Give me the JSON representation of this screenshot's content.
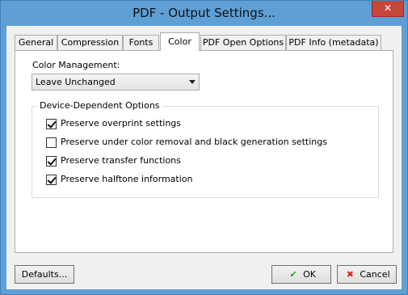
{
  "window": {
    "title": "PDF - Output Settings..."
  },
  "titlebar": {
    "close_glyph": "✕"
  },
  "tabs": [
    {
      "label": "General",
      "active": false
    },
    {
      "label": "Compression",
      "active": false
    },
    {
      "label": "Fonts",
      "active": false
    },
    {
      "label": "Color",
      "active": true
    },
    {
      "label": "PDF Open Options",
      "active": false
    },
    {
      "label": "PDF Info (metadata)",
      "active": false
    }
  ],
  "color_tab": {
    "color_management_label": "Color Management:",
    "color_management_value": "Leave Unchanged",
    "device_options": {
      "legend": "Device-Dependent Options",
      "items": [
        {
          "label": "Preserve overprint settings",
          "checked": true
        },
        {
          "label": "Preserve under color removal and black generation settings",
          "checked": false
        },
        {
          "label": "Preserve transfer functions",
          "checked": true
        },
        {
          "label": "Preserve halftone information",
          "checked": true
        }
      ]
    }
  },
  "buttons": {
    "defaults": "Defaults...",
    "ok": "OK",
    "cancel": "Cancel",
    "ok_icon": "checkmark-icon",
    "cancel_icon": "cross-icon"
  },
  "colors": {
    "title_bar": "#5e9fd6",
    "ok_green": "#2a9d2a",
    "cancel_red": "#d9281e"
  }
}
